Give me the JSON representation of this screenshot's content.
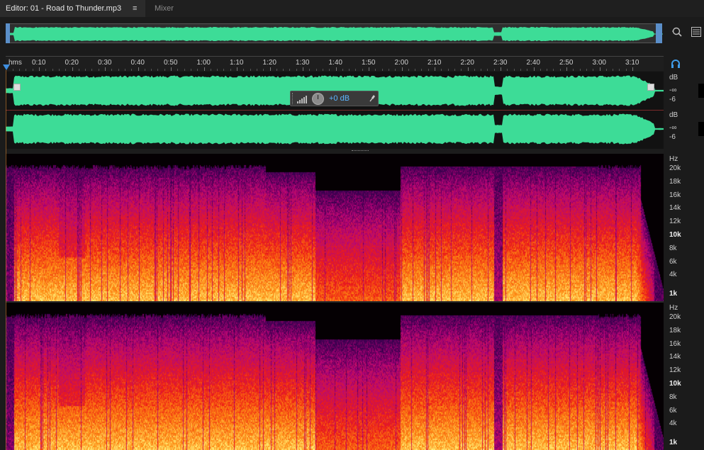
{
  "tabs": {
    "editor_label": "Editor: 01 - Road to Thunder.mp3",
    "editor_menu_icon": "≡",
    "mixer_label": "Mixer"
  },
  "icons": {
    "zoom": "zoom-icon",
    "panel_menu": "panel-menu-icon",
    "headphones": "headphones-icon",
    "pin": "pin-icon",
    "knob": "volume-knob-icon",
    "meter": "level-meter-icon"
  },
  "ruler": {
    "unit_label": "hms",
    "labels": [
      "0:10",
      "0:20",
      "0:30",
      "0:40",
      "0:50",
      "1:00",
      "1:10",
      "1:20",
      "1:30",
      "1:40",
      "1:50",
      "2:00",
      "2:10",
      "2:20",
      "2:30",
      "2:40",
      "2:50",
      "3:00",
      "3:10"
    ]
  },
  "hud": {
    "gain_label": "+0 dB",
    "pin_glyph": "📌"
  },
  "db_scale": {
    "top": {
      "unit": "dB",
      "inf": "-∞",
      "neg6": "-6"
    },
    "bottom": {
      "unit": "dB",
      "inf": "-∞",
      "neg6": "-6"
    }
  },
  "freq_scale": {
    "unit": "Hz",
    "labels": [
      "20k",
      "18k",
      "16k",
      "14k",
      "12k",
      "10k",
      "8k",
      "6k",
      "4k",
      "1k"
    ]
  },
  "colors": {
    "waveform": "#3ddc97",
    "accent": "#5bb4ff",
    "playhead": "#3f8fe0"
  }
}
